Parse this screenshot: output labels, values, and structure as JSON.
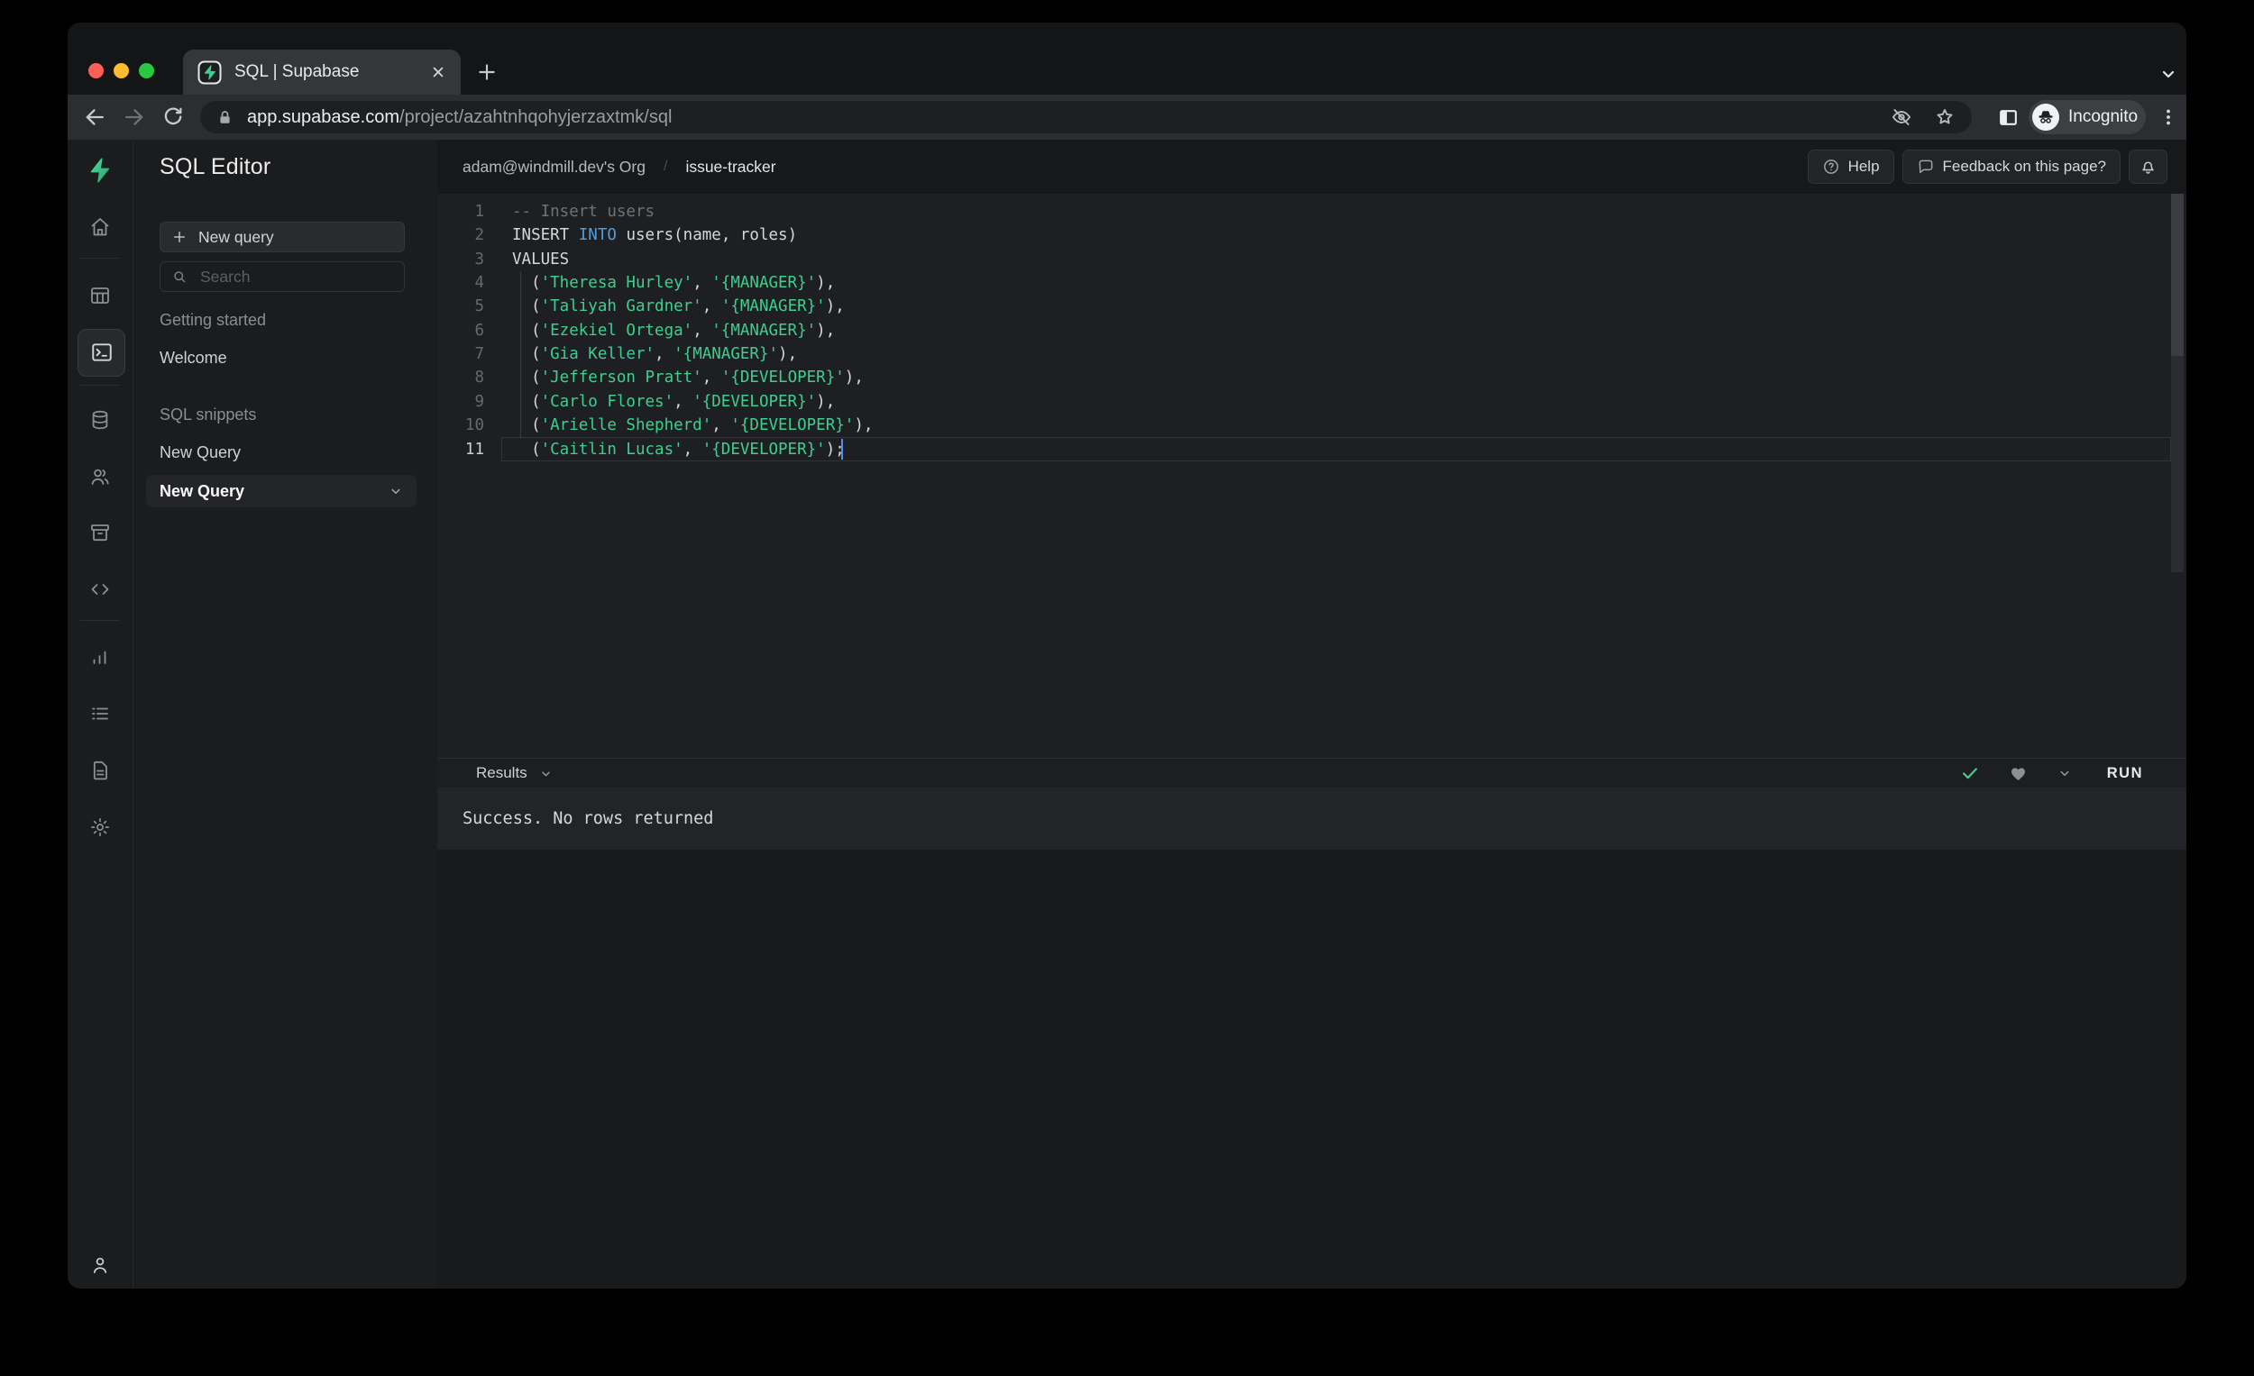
{
  "browser": {
    "tab_title": "SQL | Supabase",
    "url": {
      "host": "app.supabase.com",
      "path": "/project/azahtnhqohyjerzaxtmk/sql"
    },
    "incognito_label": "Incognito"
  },
  "app": {
    "nav_rail_icons": [
      "supabase-logo",
      "home",
      "table-editor",
      "sql-editor",
      "database",
      "authentication",
      "storage",
      "api",
      "reports",
      "logs",
      "docs",
      "settings",
      "account"
    ],
    "sidebar": {
      "title": "SQL Editor",
      "new_query_button": "New query",
      "search_placeholder": "Search",
      "sections": [
        {
          "label": "Getting started",
          "items": [
            "Welcome"
          ]
        },
        {
          "label": "SQL snippets",
          "items": [
            "New Query"
          ]
        }
      ],
      "selected_snippet": "New Query"
    },
    "header": {
      "breadcrumb": {
        "org": "adam@windmill.dev's Org",
        "separator": "/",
        "project": "issue-tracker"
      },
      "help_button": "Help",
      "feedback_button": "Feedback on this page?"
    },
    "editor": {
      "lines": [
        {
          "num": "1",
          "segments": [
            {
              "c": "com",
              "t": "-- Insert users"
            }
          ]
        },
        {
          "num": "2",
          "segments": [
            {
              "c": "pln",
              "t": "INSERT "
            },
            {
              "c": "kw",
              "t": "INTO"
            },
            {
              "c": "pln",
              "t": " users(name, roles)"
            }
          ]
        },
        {
          "num": "3",
          "segments": [
            {
              "c": "pln",
              "t": "VALUES"
            }
          ]
        },
        {
          "num": "4",
          "segments": [
            {
              "c": "pln",
              "t": "  ("
            },
            {
              "c": "str",
              "t": "'Theresa Hurley'"
            },
            {
              "c": "pln",
              "t": ", "
            },
            {
              "c": "str",
              "t": "'{MANAGER}'"
            },
            {
              "c": "pln",
              "t": "),"
            }
          ]
        },
        {
          "num": "5",
          "segments": [
            {
              "c": "pln",
              "t": "  ("
            },
            {
              "c": "str",
              "t": "'Taliyah Gardner'"
            },
            {
              "c": "pln",
              "t": ", "
            },
            {
              "c": "str",
              "t": "'{MANAGER}'"
            },
            {
              "c": "pln",
              "t": "),"
            }
          ]
        },
        {
          "num": "6",
          "segments": [
            {
              "c": "pln",
              "t": "  ("
            },
            {
              "c": "str",
              "t": "'Ezekiel Ortega'"
            },
            {
              "c": "pln",
              "t": ", "
            },
            {
              "c": "str",
              "t": "'{MANAGER}'"
            },
            {
              "c": "pln",
              "t": "),"
            }
          ]
        },
        {
          "num": "7",
          "segments": [
            {
              "c": "pln",
              "t": "  ("
            },
            {
              "c": "str",
              "t": "'Gia Keller'"
            },
            {
              "c": "pln",
              "t": ", "
            },
            {
              "c": "str",
              "t": "'{MANAGER}'"
            },
            {
              "c": "pln",
              "t": "),"
            }
          ]
        },
        {
          "num": "8",
          "segments": [
            {
              "c": "pln",
              "t": "  ("
            },
            {
              "c": "str",
              "t": "'Jefferson Pratt'"
            },
            {
              "c": "pln",
              "t": ", "
            },
            {
              "c": "str",
              "t": "'{DEVELOPER}'"
            },
            {
              "c": "pln",
              "t": "),"
            }
          ]
        },
        {
          "num": "9",
          "segments": [
            {
              "c": "pln",
              "t": "  ("
            },
            {
              "c": "str",
              "t": "'Carlo Flores'"
            },
            {
              "c": "pln",
              "t": ", "
            },
            {
              "c": "str",
              "t": "'{DEVELOPER}'"
            },
            {
              "c": "pln",
              "t": "),"
            }
          ]
        },
        {
          "num": "10",
          "segments": [
            {
              "c": "pln",
              "t": "  ("
            },
            {
              "c": "str",
              "t": "'Arielle Shepherd'"
            },
            {
              "c": "pln",
              "t": ", "
            },
            {
              "c": "str",
              "t": "'{DEVELOPER}'"
            },
            {
              "c": "pln",
              "t": "),"
            }
          ]
        },
        {
          "num": "11",
          "active": true,
          "segments": [
            {
              "c": "pln",
              "t": "  ("
            },
            {
              "c": "str",
              "t": "'Caitlin Lucas'"
            },
            {
              "c": "pln",
              "t": ", "
            },
            {
              "c": "str",
              "t": "'{DEVELOPER}'"
            },
            {
              "c": "pln",
              "t": ");"
            }
          ]
        }
      ]
    },
    "results": {
      "label": "Results",
      "run_button": "RUN",
      "message": "Success. No rows returned"
    },
    "colors": {
      "accent_green": "#3ecf8e",
      "keyword_blue": "#569cd6",
      "string_green": "#3ecf8e",
      "comment_gray": "#6e7276",
      "cursor_blue": "#4e8ef7",
      "traffic_red": "#ff5f57",
      "traffic_yellow": "#febc2e",
      "traffic_green": "#28c840"
    }
  }
}
